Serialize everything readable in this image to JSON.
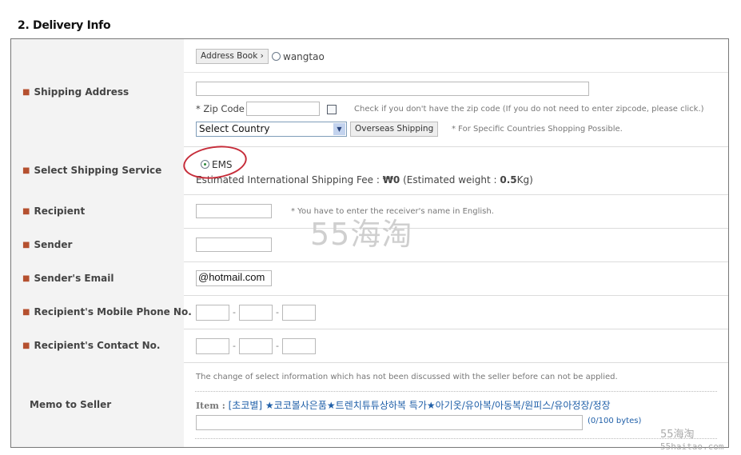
{
  "section": {
    "title": "2. Delivery Info"
  },
  "shipping_address": {
    "label": "Shipping Address",
    "address_book_button": "Address Book ›",
    "saved_address_option": "wangtao",
    "address_value": "",
    "zip_label": "* Zip Code",
    "zip_value": "",
    "no_zip_note": "Check if you don't have the zip code (If you do not need to enter zipcode, please click.)",
    "country_select": "Select Country",
    "overseas_button": "Overseas Shipping",
    "overseas_note": "* For Specific Countries Shopping Possible."
  },
  "shipping_service": {
    "label": "Select Shipping Service",
    "option": "EMS",
    "fee_prefix": "Estimated International Shipping Fee : ",
    "fee_value": "₩0",
    "weight_prefix": " (Estimated weight : ",
    "weight_value": "0.5",
    "weight_suffix": "Kg)"
  },
  "recipient": {
    "label": "Recipient",
    "value": "",
    "note": "* You have to enter the receiver's name in English."
  },
  "sender": {
    "label": "Sender",
    "value": ""
  },
  "sender_email": {
    "label": "Sender's Email",
    "value": "@hotmail.com"
  },
  "mobile_phone": {
    "label": "Recipient's Mobile Phone No.",
    "parts": [
      "",
      "",
      ""
    ],
    "separator": "-"
  },
  "contact_no": {
    "label": "Recipient's Contact No.",
    "parts": [
      "",
      "",
      ""
    ],
    "separator": "-"
  },
  "memo": {
    "label": "Memo to Seller",
    "notice": "The change of select information which has not been discussed with the seller before can not be applied.",
    "item_label": "Item :",
    "item_name": "[초코별] ★코코볼사은품★트렌치튜튜상하복 특가★아기옷/유아복/아동복/원피스/유아정장/정장",
    "value": "",
    "byte_counter": "(0/100 bytes)"
  },
  "watermarks": {
    "center": "55海淘",
    "corner": "55海淘",
    "corner_url": "55haitao.com"
  },
  "colors": {
    "bullet": "#b5502f",
    "item_link": "#1f5fa8",
    "annotation_circle": "#c62d3a"
  }
}
